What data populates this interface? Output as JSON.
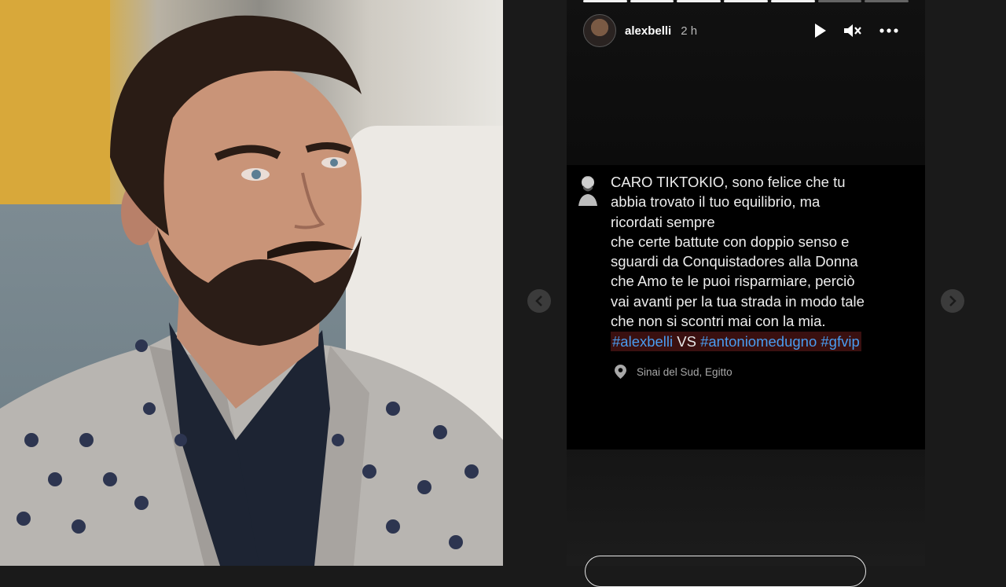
{
  "story": {
    "username": "alexbelli",
    "time": "2 h",
    "progress": {
      "segments": 7,
      "completed": 5
    },
    "icons": {
      "play": "play-icon",
      "mute": "mute-icon",
      "more": "more-icon",
      "prev": "chevron-left-icon",
      "next": "chevron-right-icon",
      "location": "location-pin-icon"
    }
  },
  "post": {
    "lines": [
      "CARO TIKTOKIO, sono felice che tu",
      "abbia trovato il tuo equilibrio, ma",
      "ricordati sempre",
      "che certe battute con doppio senso e",
      "sguardi da Conquistadores alla Donna",
      "che Amo te le puoi risparmiare, perciò",
      "vai avanti per la tua strada in modo tale",
      "che non si scontri mai con la mia."
    ],
    "hashtags": {
      "tag1": "#alexbelli",
      "vs": "VS",
      "tag2": "#antoniomedugno",
      "tag3": "#gfvip"
    },
    "location": "Sinai del Sud, Egitto"
  },
  "colors": {
    "background": "#1a1a1a",
    "hashtag": "#4a9cf0",
    "hashtag_highlight": "#3a1010"
  }
}
